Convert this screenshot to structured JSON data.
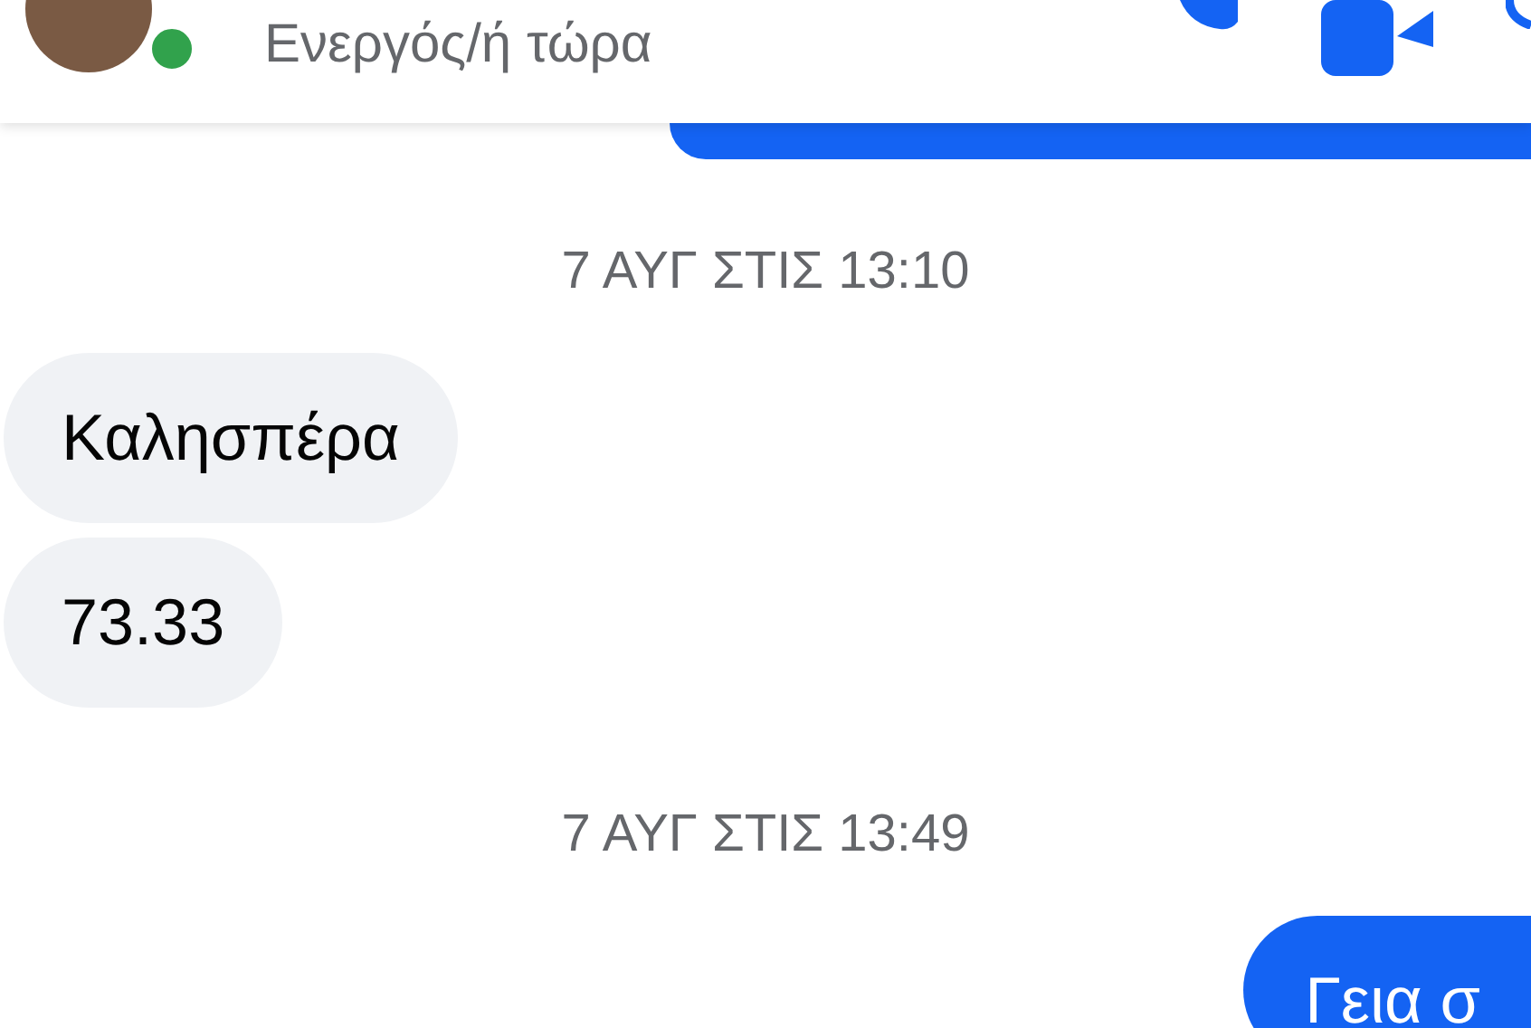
{
  "header": {
    "status": "Ενεργός/ή τώρα",
    "online": true
  },
  "messages": [
    {
      "kind": "outgoing"
    },
    {
      "kind": "timestamp",
      "text": "7 ΑΥΓ ΣΤΙΣ 13:10"
    },
    {
      "kind": "incoming",
      "text": "Καλησπέρα"
    },
    {
      "kind": "incoming",
      "text": "73.33"
    },
    {
      "kind": "timestamp",
      "text": "7 ΑΥΓ ΣΤΙΣ 13:49"
    },
    {
      "kind": "outgoing",
      "text": "Γεια σ"
    }
  ]
}
